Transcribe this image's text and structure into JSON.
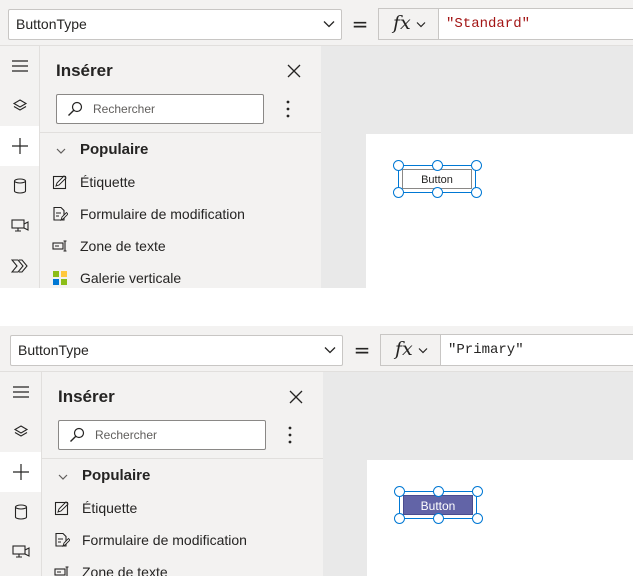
{
  "colors": {
    "accent": "#0078d4",
    "primary_button": "#6264a7",
    "string_literal": "#a31515",
    "pane_bg": "#f3f2f1",
    "canvas_bg": "#e9e9e9"
  },
  "panels": [
    {
      "property_selector": "ButtonType",
      "equals": "=",
      "fx_label": "fx",
      "formula": "\"Standard\"",
      "insert_pane": {
        "title": "Insérer",
        "search_placeholder": "Rechercher",
        "section": "Populaire",
        "items": [
          {
            "label": "Étiquette",
            "icon": "label-icon"
          },
          {
            "label": "Formulaire de modification",
            "icon": "edit-form-icon"
          },
          {
            "label": "Zone de texte",
            "icon": "text-input-icon"
          },
          {
            "label": "Galerie verticale",
            "icon": "vertical-gallery-icon"
          }
        ]
      },
      "rail": [
        "hamburger-icon",
        "layers-icon",
        "insert-plus-icon",
        "data-cylinder-icon",
        "media-icon",
        "power-automate-icon"
      ],
      "canvas_button": {
        "label": "Button",
        "type": "Standard"
      }
    },
    {
      "property_selector": "ButtonType",
      "equals": "=",
      "fx_label": "fx",
      "formula": "\"Primary\"",
      "insert_pane": {
        "title": "Insérer",
        "search_placeholder": "Rechercher",
        "section": "Populaire",
        "items": [
          {
            "label": "Étiquette",
            "icon": "label-icon"
          },
          {
            "label": "Formulaire de modification",
            "icon": "edit-form-icon"
          },
          {
            "label": "Zone de texte",
            "icon": "text-input-icon"
          }
        ]
      },
      "rail": [
        "hamburger-icon",
        "layers-icon",
        "insert-plus-icon",
        "data-cylinder-icon",
        "media-icon"
      ],
      "canvas_button": {
        "label": "Button",
        "type": "Primary"
      }
    }
  ]
}
